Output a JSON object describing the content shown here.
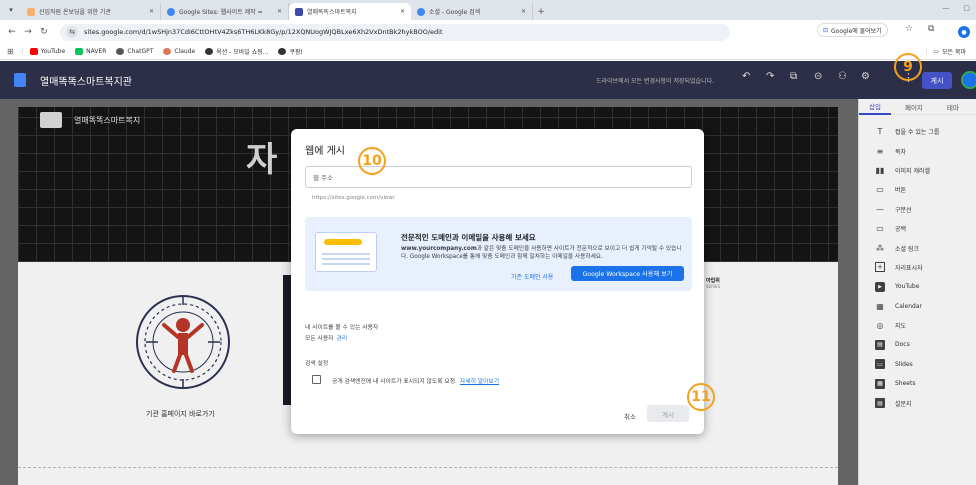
{
  "tabs": [
    {
      "label": "신입직원 온보딩을 위한 기관",
      "fav_color": "#f6b26b",
      "active": false
    },
    {
      "label": "Google Sites: 웹사이트 제작 =",
      "fav_color": "#4285f4",
      "active": false
    },
    {
      "label": "열매똑똑스마트복지",
      "fav_color": "#3c4aa8",
      "active": true
    },
    {
      "label": "소셜 - Google 검색",
      "fav_color": "#4285f4",
      "active": false
    }
  ],
  "address": {
    "url": "sites.google.com/d/1wSHjn37Cdi6CttOHtV4Zks6TH6LKk8Gy/p/12XQNUogWJQBLxe6Xh2VxDntBk2hykBOO/edit",
    "google_lens_label": "Google에 물어보기"
  },
  "bookmarks": [
    {
      "label": "YouTube",
      "color": "#ff0000"
    },
    {
      "label": "NAVER",
      "color": "#03c75a"
    },
    {
      "label": "ChatGPT",
      "color": "#555555"
    },
    {
      "label": "Claude",
      "color": "#d97757"
    },
    {
      "label": "옥션 - 모바일 쇼핑...",
      "color": "#333333"
    },
    {
      "label": "쿠팡!",
      "color": "#333333"
    }
  ],
  "bookmarks_right": "모든 북마",
  "header": {
    "site_name": "열매똑똑스마트복지관",
    "save_status": "드라이브에서 모든 변경사항이 저장되었습니다.",
    "publish_label": "게시"
  },
  "canvas": {
    "banner_site_name": "열매똑똑스마트복지",
    "big_title": "자",
    "homepage_link": "기관 홈페이지 바로가기",
    "right_caption": "아업위",
    "right_caption2": "SERIES"
  },
  "panel": {
    "tabs": [
      "삽입",
      "페이지",
      "테마"
    ],
    "items": [
      {
        "label": "접을 수 있는 그룹",
        "icon": "T"
      },
      {
        "label": "목차",
        "icon": "≡"
      },
      {
        "label": "이미지 캐러셀",
        "icon": "▯▯"
      },
      {
        "label": "버튼",
        "icon": "▭"
      },
      {
        "label": "구분선",
        "icon": "—"
      },
      {
        "label": "공백",
        "icon": "▭"
      },
      {
        "label": "소셜 링크",
        "icon": "⁂"
      },
      {
        "label": "자리표시자",
        "icon": "+"
      },
      {
        "label": "YouTube",
        "icon": "▶"
      },
      {
        "label": "Calendar",
        "icon": "▦"
      },
      {
        "label": "지도",
        "icon": "◎"
      },
      {
        "label": "Docs",
        "icon": "▤"
      },
      {
        "label": "Slides",
        "icon": "▭"
      },
      {
        "label": "Sheets",
        "icon": "▦"
      },
      {
        "label": "설문지",
        "icon": "▤"
      }
    ]
  },
  "dialog": {
    "title": "웹에 게시",
    "url_placeholder": "웹 주소",
    "url_hint": "https://sites.google.com/view/",
    "promo_title": "전문적인 도메인과 이메일을 사용해 보세요",
    "promo_bold": "www.yourcompany.com",
    "promo_text": "과 같은 맞춤 도메인을 사용하면 사이트가 전문적으로 보이고 더 쉽게 기억될 수 있습니다. Google Workspace를 통해 맞춤 도메인과 함께 일치하는 이메일을 사용하세요.",
    "promo_link": "기존 도메인 사용",
    "promo_button": "Google Workspace 사용해 보기",
    "viewers_heading": "내 사이트를 볼 수 있는 사용자",
    "viewers_value": "모든 사용자",
    "viewers_manage": "관리",
    "search_heading": "검색 설정",
    "search_checkbox_label": "공개 검색엔진에 내 사이트가 표시되지 않도록 요청.",
    "search_learn_more": "자세히 알아보기",
    "cancel_label": "취소",
    "publish_label": "게시"
  },
  "annotations": {
    "step9": "9",
    "step10": "10",
    "step11": "11",
    "color": "#f5a11c"
  }
}
